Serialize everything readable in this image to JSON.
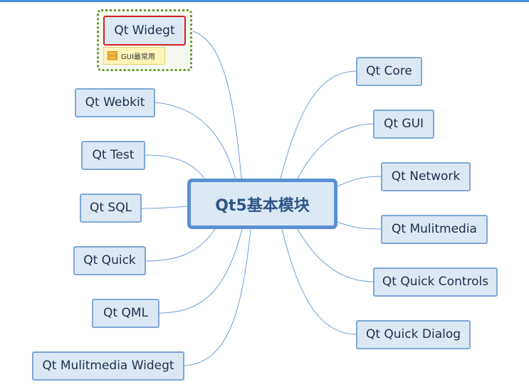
{
  "central": {
    "label": "Qt5基本模块"
  },
  "note": {
    "text": "GUI最常用"
  },
  "left_nodes": [
    {
      "id": "qt-widegt",
      "label": "Qt Widegt"
    },
    {
      "id": "qt-webkit",
      "label": "Qt Webkit"
    },
    {
      "id": "qt-test",
      "label": "Qt Test"
    },
    {
      "id": "qt-sql",
      "label": "Qt SQL"
    },
    {
      "id": "qt-quick",
      "label": "Qt Quick"
    },
    {
      "id": "qt-qml",
      "label": "Qt QML"
    },
    {
      "id": "qt-mulitmedia-widegt",
      "label": "Qt Mulitmedia Widegt"
    }
  ],
  "right_nodes": [
    {
      "id": "qt-core",
      "label": "Qt Core"
    },
    {
      "id": "qt-gui",
      "label": "Qt GUI"
    },
    {
      "id": "qt-network",
      "label": "Qt Network"
    },
    {
      "id": "qt-mulitmedia",
      "label": "Qt Mulitmedia"
    },
    {
      "id": "qt-quick-controls",
      "label": "Qt Quick Controls"
    },
    {
      "id": "qt-quick-dialog",
      "label": "Qt Quick Dialog"
    }
  ],
  "colors": {
    "node_fill": "#dde8f5",
    "node_border": "#7ea7d8",
    "central_border": "#5a8fd4",
    "connector": "#6f9fd6",
    "selected_border": "#d52020",
    "selection_dots": "#6a9a30",
    "note_fill": "#fff5b8"
  }
}
